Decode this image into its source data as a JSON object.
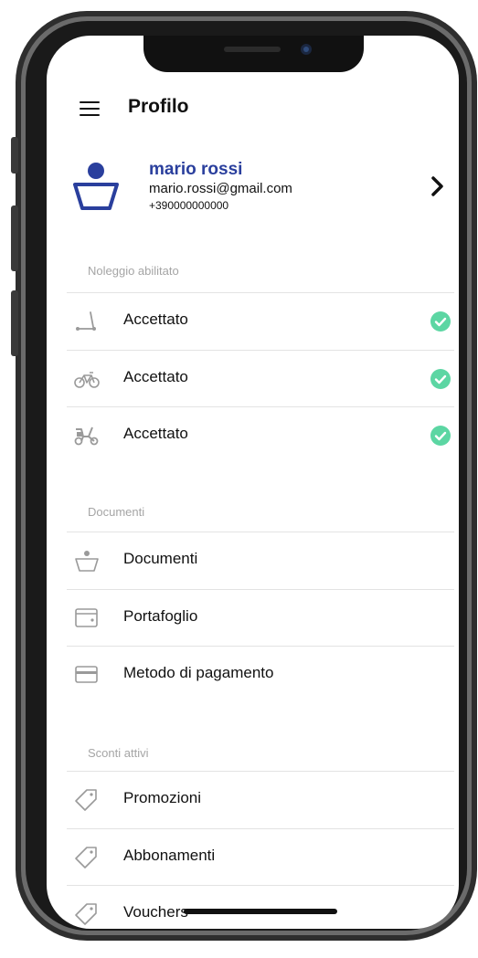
{
  "header": {
    "title": "Profilo"
  },
  "profile": {
    "name": "mario rossi",
    "email": "mario.rossi@gmail.com",
    "phone": "+390000000000"
  },
  "rental": {
    "section_label": "Noleggio abilitato",
    "items": [
      {
        "icon": "scooter-icon",
        "label": "Accettato",
        "status": "accepted"
      },
      {
        "icon": "bicycle-icon",
        "label": "Accettato",
        "status": "accepted"
      },
      {
        "icon": "moped-icon",
        "label": "Accettato",
        "status": "accepted"
      }
    ]
  },
  "documents": {
    "section_label": "Documenti",
    "items": [
      {
        "icon": "user-document-icon",
        "label": "Documenti"
      },
      {
        "icon": "wallet-icon",
        "label": "Portafoglio"
      },
      {
        "icon": "credit-card-icon",
        "label": "Metodo di pagamento"
      }
    ]
  },
  "discounts": {
    "section_label": "Sconti attivi",
    "items": [
      {
        "icon": "tag-icon",
        "label": "Promozioni"
      },
      {
        "icon": "tag-icon",
        "label": "Abbonamenti"
      },
      {
        "icon": "tag-icon",
        "label": "Vouchers"
      }
    ]
  },
  "colors": {
    "accent": "#2a3f9d",
    "check": "#5cd6a3",
    "icon": "#9a9a9a"
  }
}
